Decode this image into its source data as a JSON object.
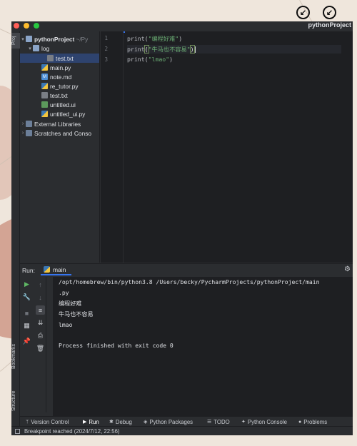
{
  "window": {
    "project_name": "pythonProject"
  },
  "traffic_lights": [
    "#ff5f57",
    "#febc2e",
    "#28c840"
  ],
  "left_strip": {
    "top_label": "Proj",
    "bookmarks_label": "Bookmarks",
    "structure_label": "Structure"
  },
  "project_tree": {
    "root": {
      "label": "pythonProject",
      "hint": "~/Py"
    },
    "log_folder": "log",
    "items": [
      {
        "label": "test.txt",
        "icon": "text-file-icon"
      },
      {
        "label": "main.py",
        "icon": "python-file-icon"
      },
      {
        "label": "note.md",
        "icon": "markdown-file-icon"
      },
      {
        "label": "re_tutor.py",
        "icon": "python-file-icon"
      },
      {
        "label": "test.txt",
        "icon": "text-file-icon"
      },
      {
        "label": "untitled.ui",
        "icon": "ui-file-icon"
      },
      {
        "label": "untitled_ui.py",
        "icon": "python-file-icon"
      }
    ],
    "external_libraries": "External Libraries",
    "scratches": "Scratches and Conso"
  },
  "editor": {
    "line_numbers": [
      "1",
      "2",
      "3"
    ],
    "lines": [
      {
        "fn": "print",
        "open": "(",
        "str": "\"编程好难\"",
        "close": ")"
      },
      {
        "fn": "print",
        "open": "(",
        "str": "\"牛马也不容易\"",
        "close": ")"
      },
      {
        "fn": "print",
        "open": "(",
        "str": "\"lmao\"",
        "close": ")"
      }
    ]
  },
  "run_panel": {
    "label": "Run:",
    "tab": "main",
    "console_lines": [
      "/opt/homebrew/bin/python3.8 /Users/becky/PycharmProjects/pythonProject/main",
      " .py",
      "编程好难",
      "牛马也不容易",
      "lmao",
      "",
      "Process finished with exit code 0"
    ]
  },
  "bottom_tabs": [
    {
      "label": "Version Control",
      "icon": "branch-icon"
    },
    {
      "label": "Run",
      "icon": "play-icon",
      "active": true
    },
    {
      "label": "Debug",
      "icon": "bug-icon"
    },
    {
      "label": "Python Packages",
      "icon": "layers-icon"
    },
    {
      "label": "TODO",
      "icon": "list-icon"
    },
    {
      "label": "Python Console",
      "icon": "python-icon"
    },
    {
      "label": "Problems",
      "icon": "info-icon"
    }
  ],
  "status": {
    "text": "Breakpoint reached (2024/7/12, 22:56)"
  },
  "colors": {
    "string": "#6aab73",
    "selection": "#2e436e",
    "accent": "#3574f0",
    "run_green": "#5fb865"
  }
}
